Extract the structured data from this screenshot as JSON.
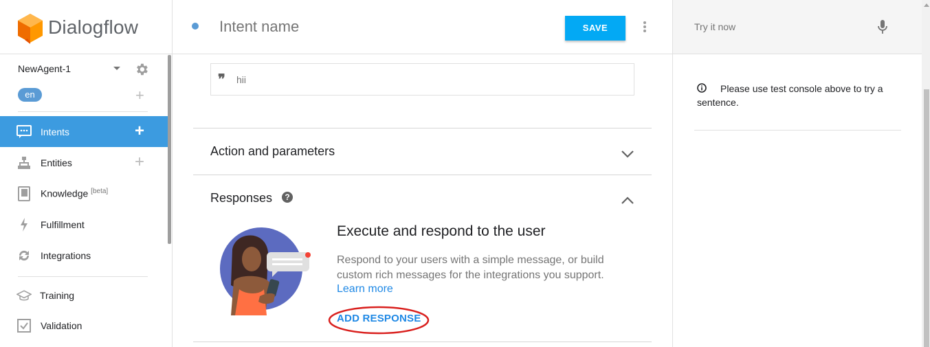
{
  "app": {
    "name": "Dialogflow"
  },
  "sidebar": {
    "agent_name": "NewAgent-1",
    "language": "en",
    "items": [
      {
        "label": "Intents",
        "beta": "",
        "active": true,
        "has_add": true,
        "icon": "chat-icon"
      },
      {
        "label": "Entities",
        "beta": "",
        "active": false,
        "has_add": true,
        "icon": "hierarchy-icon"
      },
      {
        "label": "Knowledge ",
        "beta": "[beta]",
        "active": false,
        "has_add": false,
        "icon": "book-icon"
      },
      {
        "label": "Fulfillment",
        "beta": "",
        "active": false,
        "has_add": false,
        "icon": "bolt-icon"
      },
      {
        "label": "Integrations",
        "beta": "",
        "active": false,
        "has_add": false,
        "icon": "sync-icon"
      },
      {
        "label": "Training",
        "beta": "",
        "active": false,
        "has_add": false,
        "icon": "graduation-cap-icon"
      },
      {
        "label": "Validation",
        "beta": "",
        "active": false,
        "has_add": false,
        "icon": "checkbox-icon"
      }
    ]
  },
  "header": {
    "intent_name_placeholder": "Intent name",
    "save_label": "SAVE"
  },
  "training_phrase": {
    "text": "hii"
  },
  "sections": {
    "action_title": "Action and parameters",
    "responses_title": "Responses"
  },
  "responses_empty": {
    "title": "Execute and respond to the user",
    "description": "Respond to your users with a simple message, or build custom rich messages for the integrations you support.",
    "learn_more": "Learn more",
    "add_response": "ADD RESPONSE"
  },
  "right_panel": {
    "try_placeholder": "Try it now",
    "info_text": "Please use test console above to try a sentence."
  },
  "colors": {
    "accent": "#03a9f4",
    "active_nav": "#3c9be0",
    "link": "#1e88e5",
    "annotation": "#d9201e"
  }
}
